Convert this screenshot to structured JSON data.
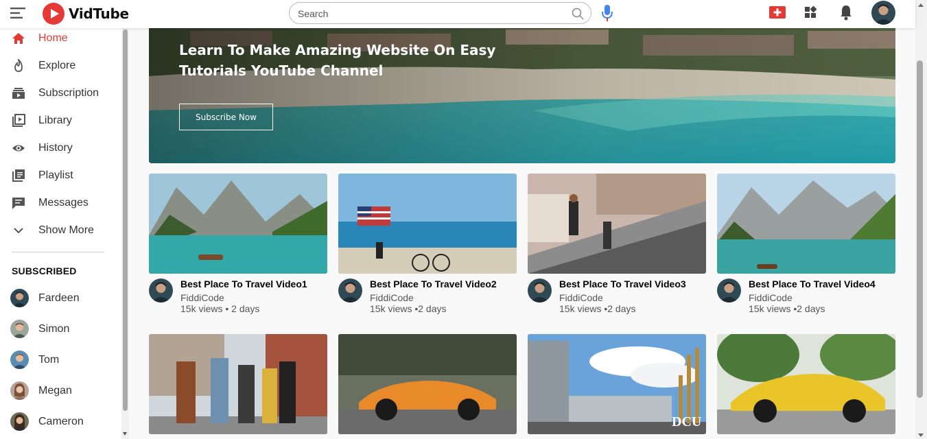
{
  "app": {
    "name": "VidTube"
  },
  "search": {
    "placeholder": "Search"
  },
  "sidebar": {
    "items": [
      {
        "label": "Home",
        "icon": "home-icon"
      },
      {
        "label": "Explore",
        "icon": "fire-icon"
      },
      {
        "label": "Subscription",
        "icon": "subscription-icon"
      },
      {
        "label": "Library",
        "icon": "library-icon"
      },
      {
        "label": "History",
        "icon": "eye-icon"
      },
      {
        "label": "Playlist",
        "icon": "playlist-icon"
      },
      {
        "label": "Messages",
        "icon": "message-icon"
      },
      {
        "label": "Show More",
        "icon": "chevron-down-icon"
      }
    ],
    "subscribed_title": "SUBSCRIBED",
    "subscriptions": [
      "Fardeen",
      "Simon",
      "Tom",
      "Megan",
      "Cameron"
    ]
  },
  "banner": {
    "title": "Learn To Make Amazing Website On Easy Tutorials YouTube Channel",
    "button": "Subscribe Now"
  },
  "videos": [
    {
      "title": "Best Place To Travel Video1",
      "channel": "FiddiCode",
      "meta": "15k views • 2 days"
    },
    {
      "title": "Best Place To Travel Video2",
      "channel": "FiddiCode",
      "meta": "15k views •2 days"
    },
    {
      "title": "Best Place To Travel Video3",
      "channel": "FiddiCode",
      "meta": "15k views •2 days"
    },
    {
      "title": "Best Place To Travel Video4",
      "channel": "FiddiCode",
      "meta": "15k views •2 days"
    }
  ],
  "thumb_text": {
    "dcu": "DCU"
  },
  "colors": {
    "accent": "#e53935",
    "mic_blue": "#4285f4"
  }
}
